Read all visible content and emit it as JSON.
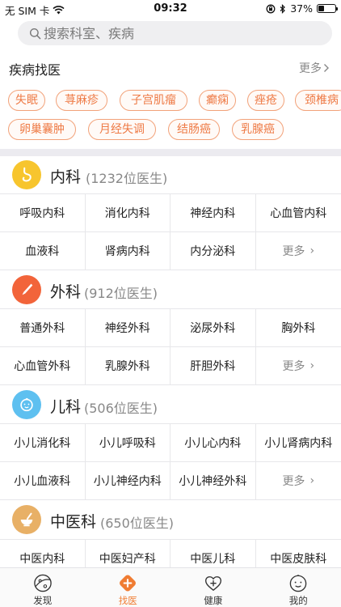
{
  "status_bar": {
    "carrier": "无 SIM 卡",
    "time": "09:32",
    "battery_pct": "37%",
    "battery_level": 0.37
  },
  "search": {
    "placeholder": "搜索科室、疾病"
  },
  "disease_section": {
    "title": "疾病找医",
    "more_label": "更多",
    "rows": [
      [
        "失眠",
        "荨麻疹",
        "子宫肌瘤",
        "癫痫",
        "痤疮",
        "颈椎病"
      ],
      [
        "卵巢囊肿",
        "月经失调",
        "结肠癌",
        "乳腺癌"
      ]
    ]
  },
  "departments": [
    {
      "name": "内科",
      "count": "(1232位医生)",
      "icon": "stomach-icon",
      "color": "#f7c52e",
      "rows": [
        [
          "呼吸内科",
          "消化内科",
          "神经内科",
          "心血管内科"
        ],
        [
          "血液科",
          "肾病内科",
          "内分泌科",
          "更多"
        ]
      ]
    },
    {
      "name": "外科",
      "count": "(912位医生)",
      "icon": "scalpel-icon",
      "color": "#f2643a",
      "rows": [
        [
          "普通外科",
          "神经外科",
          "泌尿外科",
          "胸外科"
        ],
        [
          "心血管外科",
          "乳腺外科",
          "肝胆外科",
          "更多"
        ]
      ]
    },
    {
      "name": "儿科",
      "count": "(506位医生)",
      "icon": "baby-icon",
      "color": "#5ec0f0",
      "rows": [
        [
          "小儿消化科",
          "小儿呼吸科",
          "小儿心内科",
          "小儿肾病内科"
        ],
        [
          "小儿血液科",
          "小儿神经内科",
          "小儿神经外科",
          "更多"
        ]
      ]
    },
    {
      "name": "中医科",
      "count": "(650位医生)",
      "icon": "mortar-icon",
      "color": "#e8b066",
      "rows": [
        [
          "中医内科",
          "中医妇产科",
          "中医儿科",
          "中医皮肤科"
        ]
      ]
    }
  ],
  "tabbar": {
    "items": [
      {
        "label": "发现",
        "icon": "planet-icon",
        "active": false
      },
      {
        "label": "找医",
        "icon": "plus-cross-icon",
        "active": true
      },
      {
        "label": "健康",
        "icon": "heart-plus-icon",
        "active": false
      },
      {
        "label": "我的",
        "icon": "smiley-icon",
        "active": false
      }
    ],
    "accent": "#f07c32"
  }
}
